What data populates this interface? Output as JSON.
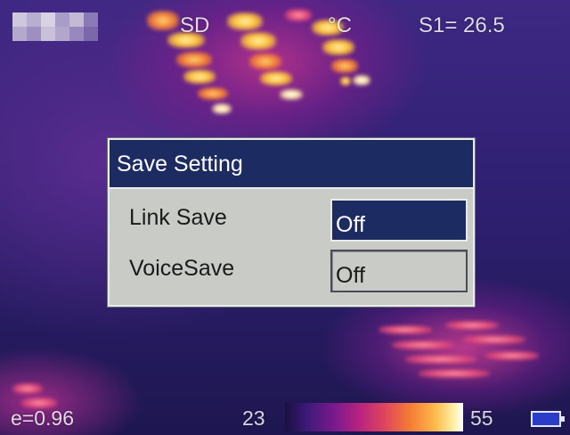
{
  "hud": {
    "storage_label": "SD",
    "unit_label": "°C",
    "spot_readout": "S1= 26.5",
    "emissivity": "e=0.96",
    "scale_min": "23",
    "scale_max": "55",
    "battery_icon": "battery-icon"
  },
  "dialog": {
    "title": "Save Setting",
    "rows": [
      {
        "label": "Link Save",
        "value": "Off",
        "selected": true
      },
      {
        "label": "VoiceSave",
        "value": "Off",
        "selected": false
      }
    ]
  },
  "colors": {
    "dialog_title_bg": "#1d2b63",
    "dialog_bg": "#c9ccc6",
    "hud_text": "#ffffff"
  }
}
